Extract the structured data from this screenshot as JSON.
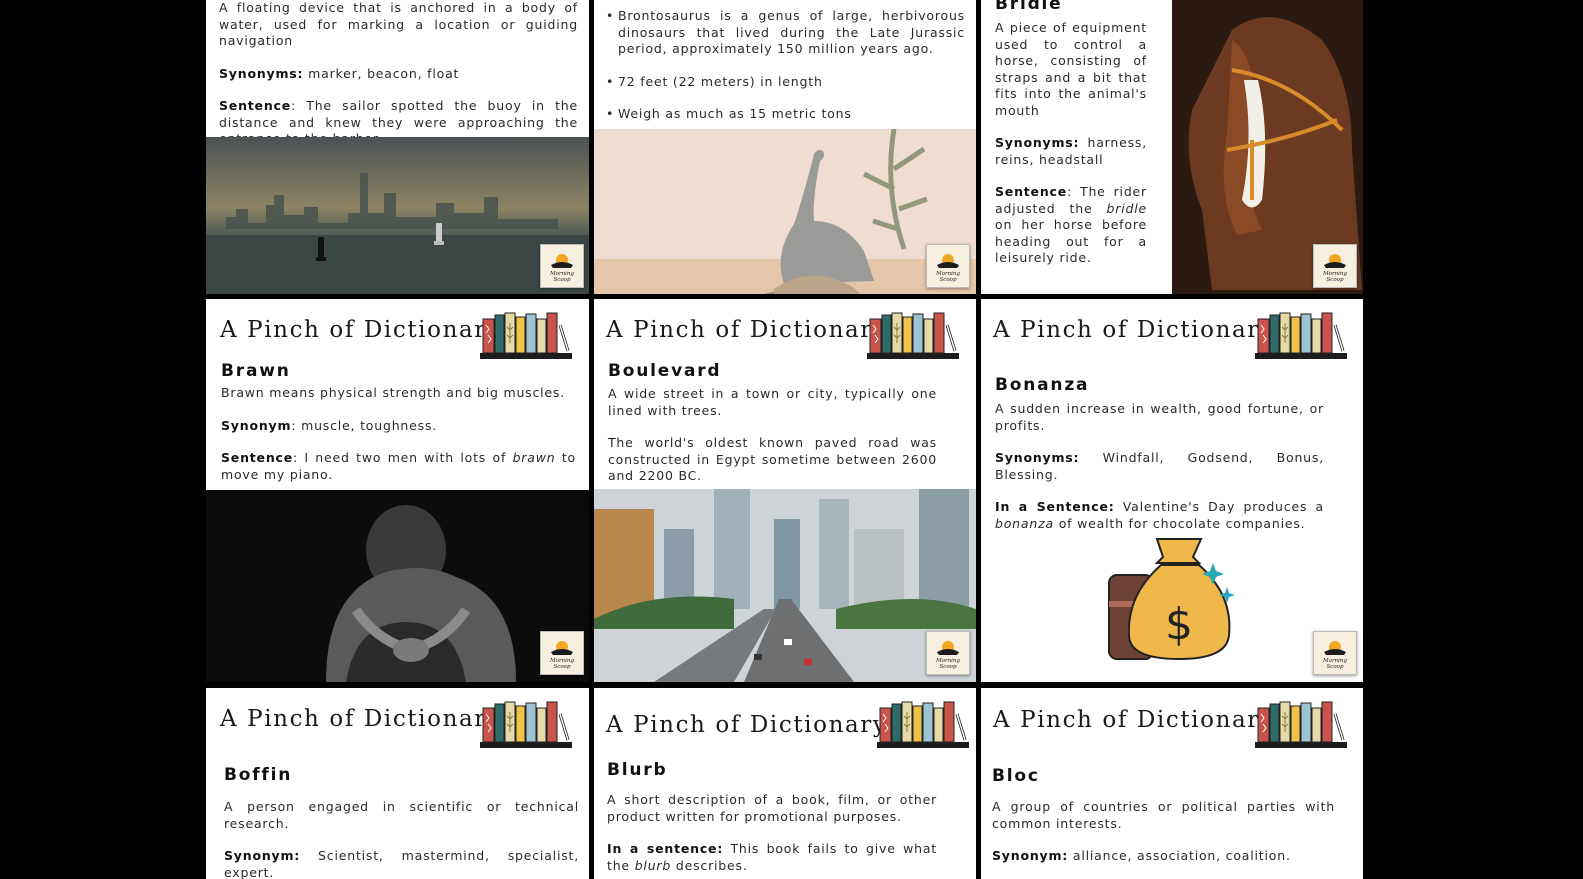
{
  "brand": "A Pinch of Dictionary",
  "badge_text": "Morning Scoop",
  "colors": {
    "background": "#000000",
    "card": "#ffffff",
    "bag": "#f0b84a",
    "book_red": "#c9544c",
    "book_teal": "#2f6b68"
  },
  "cards": {
    "buoy": {
      "definition": "A floating device that is anchored in a body of water, used for marking a location or guiding navigation",
      "synonyms_label": "Synonyms:",
      "synonyms": " marker, beacon, float",
      "sentence_label": "Sentence",
      "sentence": ": The sailor spotted the buoy in the distance and knew they were approaching the entrance to the harbor."
    },
    "brontosaurus": {
      "fact1": "Brontosaurus is a genus of large, herbivorous dinosaurs that lived during the Late Jurassic period, approximately 150 million years ago.",
      "fact2": "72 feet (22 meters) in length",
      "fact3": "Weigh as much as 15 metric tons"
    },
    "bridle": {
      "word": "Bridle",
      "definition": "A piece of equipment used to control a horse, consisting of straps and a bit that fits into the animal's mouth",
      "synonyms_label": "Synonyms:",
      "synonyms": " harness, reins, headstall",
      "sentence_label": "Sentence",
      "sentence_a": ": The rider adjusted the ",
      "sentence_em": "bridle",
      "sentence_b": " on her horse before heading out for a leisurely ride."
    },
    "brawn": {
      "word": "Brawn",
      "definition": "Brawn means physical strength and big muscles.",
      "synonyms_label": "Synonym",
      "synonyms": ": muscle, toughness.",
      "sentence_label": "Sentence",
      "sentence_a": ":  I need two men with lots of ",
      "sentence_em": "brawn",
      "sentence_b": " to move my piano."
    },
    "boulevard": {
      "word": "Boulevard",
      "definition": "A wide street in a town or city, typically one lined with trees.",
      "fact": "The world's oldest known paved road was constructed in Egypt sometime between 2600 and 2200 BC."
    },
    "bonanza": {
      "word": "Bonanza",
      "definition": "A sudden increase in wealth, good fortune, or profits.",
      "synonyms_label": "Synonyms:",
      "synonyms": " Windfall, Godsend, Bonus, Blessing.",
      "sentence_label": "In a Sentence:",
      "sentence_a": " Valentine's Day produces a ",
      "sentence_em": "bonanza",
      "sentence_b": " of wealth for chocolate companies."
    },
    "boffin": {
      "word": "Boffin",
      "definition": "A person engaged in scientific or technical research.",
      "synonyms_label": "Synonym:",
      "synonyms": " Scientist, mastermind, specialist, expert."
    },
    "blurb": {
      "word": "Blurb",
      "definition": "A short description of a book, film, or other product written for promotional purposes.",
      "sentence_label": "In a sentence:",
      "sentence_a": " This book fails to give what the ",
      "sentence_em": "blurb",
      "sentence_b": " describes."
    },
    "bloc": {
      "word": "Bloc",
      "definition": "A group of countries or political parties with common interests.",
      "synonyms_label": "Synonym:",
      "synonyms": " alliance, association, coalition."
    }
  }
}
